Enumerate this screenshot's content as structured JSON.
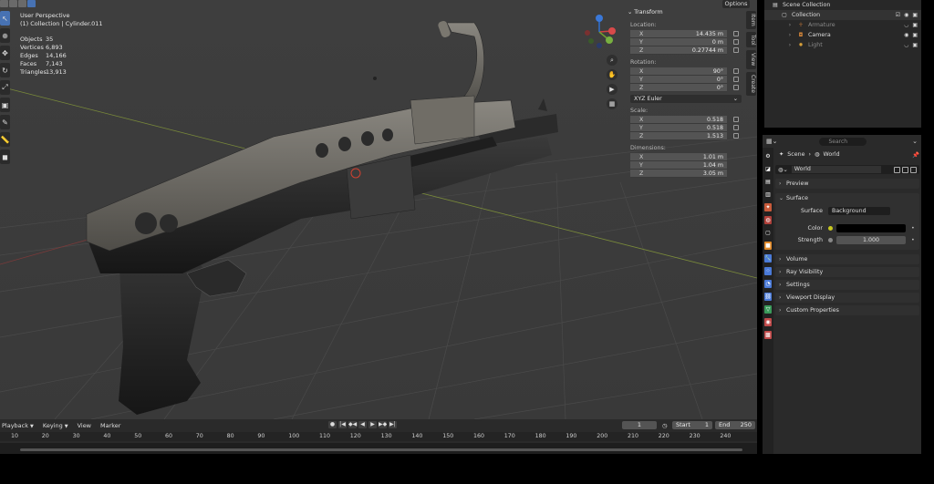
{
  "viewport": {
    "view_name": "User Perspective",
    "collection_path": "(1) Collection | Cylinder.011",
    "stats": [
      {
        "k": "Objects",
        "v": "35"
      },
      {
        "k": "Vertices",
        "v": "6,893"
      },
      {
        "k": "Edges",
        "v": "14,166"
      },
      {
        "k": "Faces",
        "v": "7,143"
      },
      {
        "k": "Triangles",
        "v": "13,913"
      }
    ],
    "options_label": "Options",
    "side_tabs": [
      "Item",
      "Tool",
      "View",
      "Create"
    ]
  },
  "npanel": {
    "title": "Transform",
    "location_label": "Location:",
    "location": [
      {
        "ax": "X",
        "v": "14.435 m"
      },
      {
        "ax": "Y",
        "v": "0 m"
      },
      {
        "ax": "Z",
        "v": "0.27744 m"
      }
    ],
    "rotation_label": "Rotation:",
    "rotation": [
      {
        "ax": "X",
        "v": "90°"
      },
      {
        "ax": "Y",
        "v": "0°"
      },
      {
        "ax": "Z",
        "v": "0°"
      }
    ],
    "rotation_mode": "XYZ Euler",
    "scale_label": "Scale:",
    "scale": [
      {
        "ax": "X",
        "v": "0.518"
      },
      {
        "ax": "Y",
        "v": "0.518"
      },
      {
        "ax": "Z",
        "v": "1.513"
      }
    ],
    "dimensions_label": "Dimensions:",
    "dimensions": [
      {
        "ax": "X",
        "v": "1.01 m"
      },
      {
        "ax": "Y",
        "v": "1.04 m"
      },
      {
        "ax": "Z",
        "v": "3.05 m"
      }
    ]
  },
  "outliner": {
    "rows": [
      {
        "label": "Scene Collection"
      },
      {
        "label": "Collection"
      },
      {
        "label": "Armature"
      },
      {
        "label": "Camera"
      },
      {
        "label": "Light"
      }
    ]
  },
  "properties": {
    "search_placeholder": "Search",
    "crumb_scene": "Scene",
    "crumb_world": "World",
    "world_name": "World",
    "panels": {
      "preview": "Preview",
      "surface": "Surface",
      "volume": "Volume",
      "ray_visibility": "Ray Visibility",
      "settings": "Settings",
      "viewport_display": "Viewport Display",
      "custom_properties": "Custom Properties"
    },
    "surface_label": "Surface",
    "surface_value": "Background",
    "color_label": "Color",
    "strength_label": "Strength",
    "strength_value": "1.000"
  },
  "timeline": {
    "menus": [
      "Playback",
      "Keying",
      "View",
      "Marker"
    ],
    "current_frame": "1",
    "start_label": "Start",
    "start_value": "1",
    "end_label": "End",
    "end_value": "250",
    "ruler": [
      "10",
      "20",
      "30",
      "40",
      "50",
      "60",
      "70",
      "80",
      "90",
      "100",
      "110",
      "120",
      "130",
      "140",
      "150",
      "160",
      "170",
      "180",
      "190",
      "200",
      "210",
      "220",
      "230",
      "240"
    ]
  }
}
